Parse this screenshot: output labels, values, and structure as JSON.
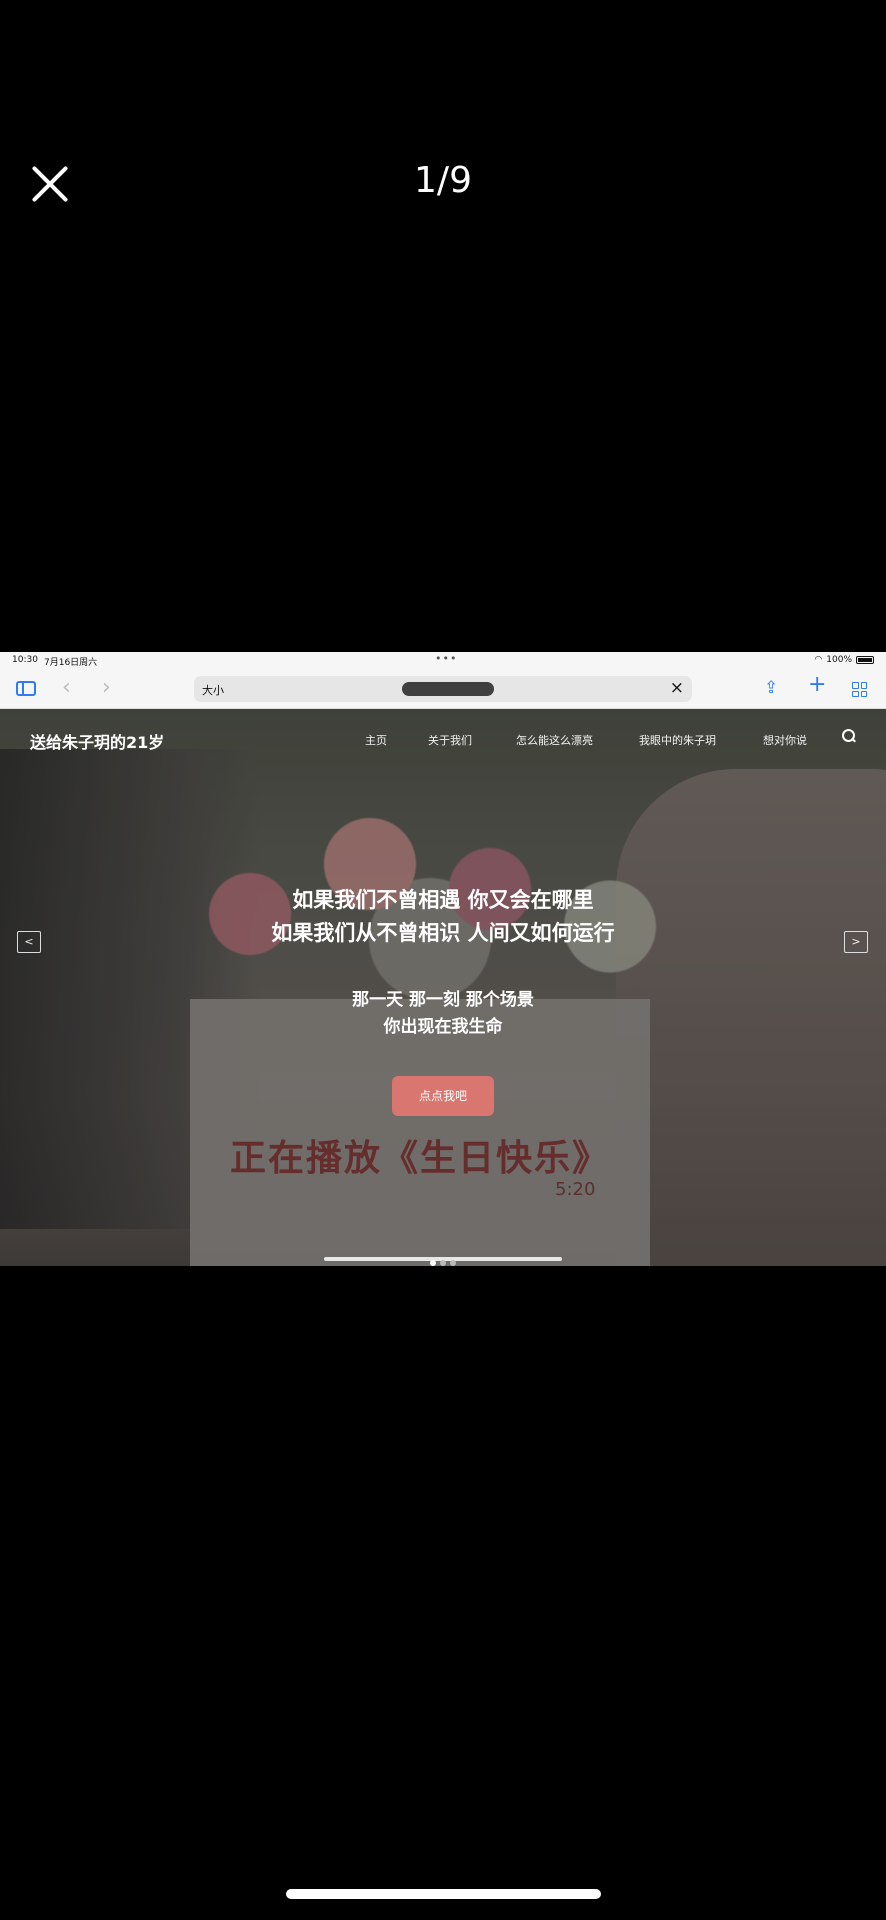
{
  "viewer": {
    "counter": "1/9",
    "close_icon": "close-icon"
  },
  "screenshot": {
    "status_bar": {
      "time": "10:30",
      "date": "7月16日周六",
      "battery": "100%"
    },
    "toolbar": {
      "address_prefix": "大小",
      "icons": [
        "sidebar-icon",
        "back-icon",
        "forward-icon",
        "clear-icon",
        "share-icon",
        "plus-icon",
        "tabs-icon"
      ]
    },
    "site": {
      "title": "送给朱子玥的21岁",
      "nav": [
        "主页",
        "关于我们",
        "怎么能这么漂亮",
        "我眼中的朱子玥",
        "想对你说"
      ]
    },
    "hero": {
      "line1": "如果我们不曾相遇 你又会在哪里",
      "line2": "如果我们从不曾相识 人间又如何运行",
      "line3": "那一天 那一刻 那个场景",
      "line4": "你出现在我生命",
      "cta": "点点我吧",
      "prev": "<",
      "next": ">",
      "bag_text": "正在播放《生日快乐》",
      "bag_time": "5:20",
      "slides": 3,
      "active_slide": 1
    }
  }
}
